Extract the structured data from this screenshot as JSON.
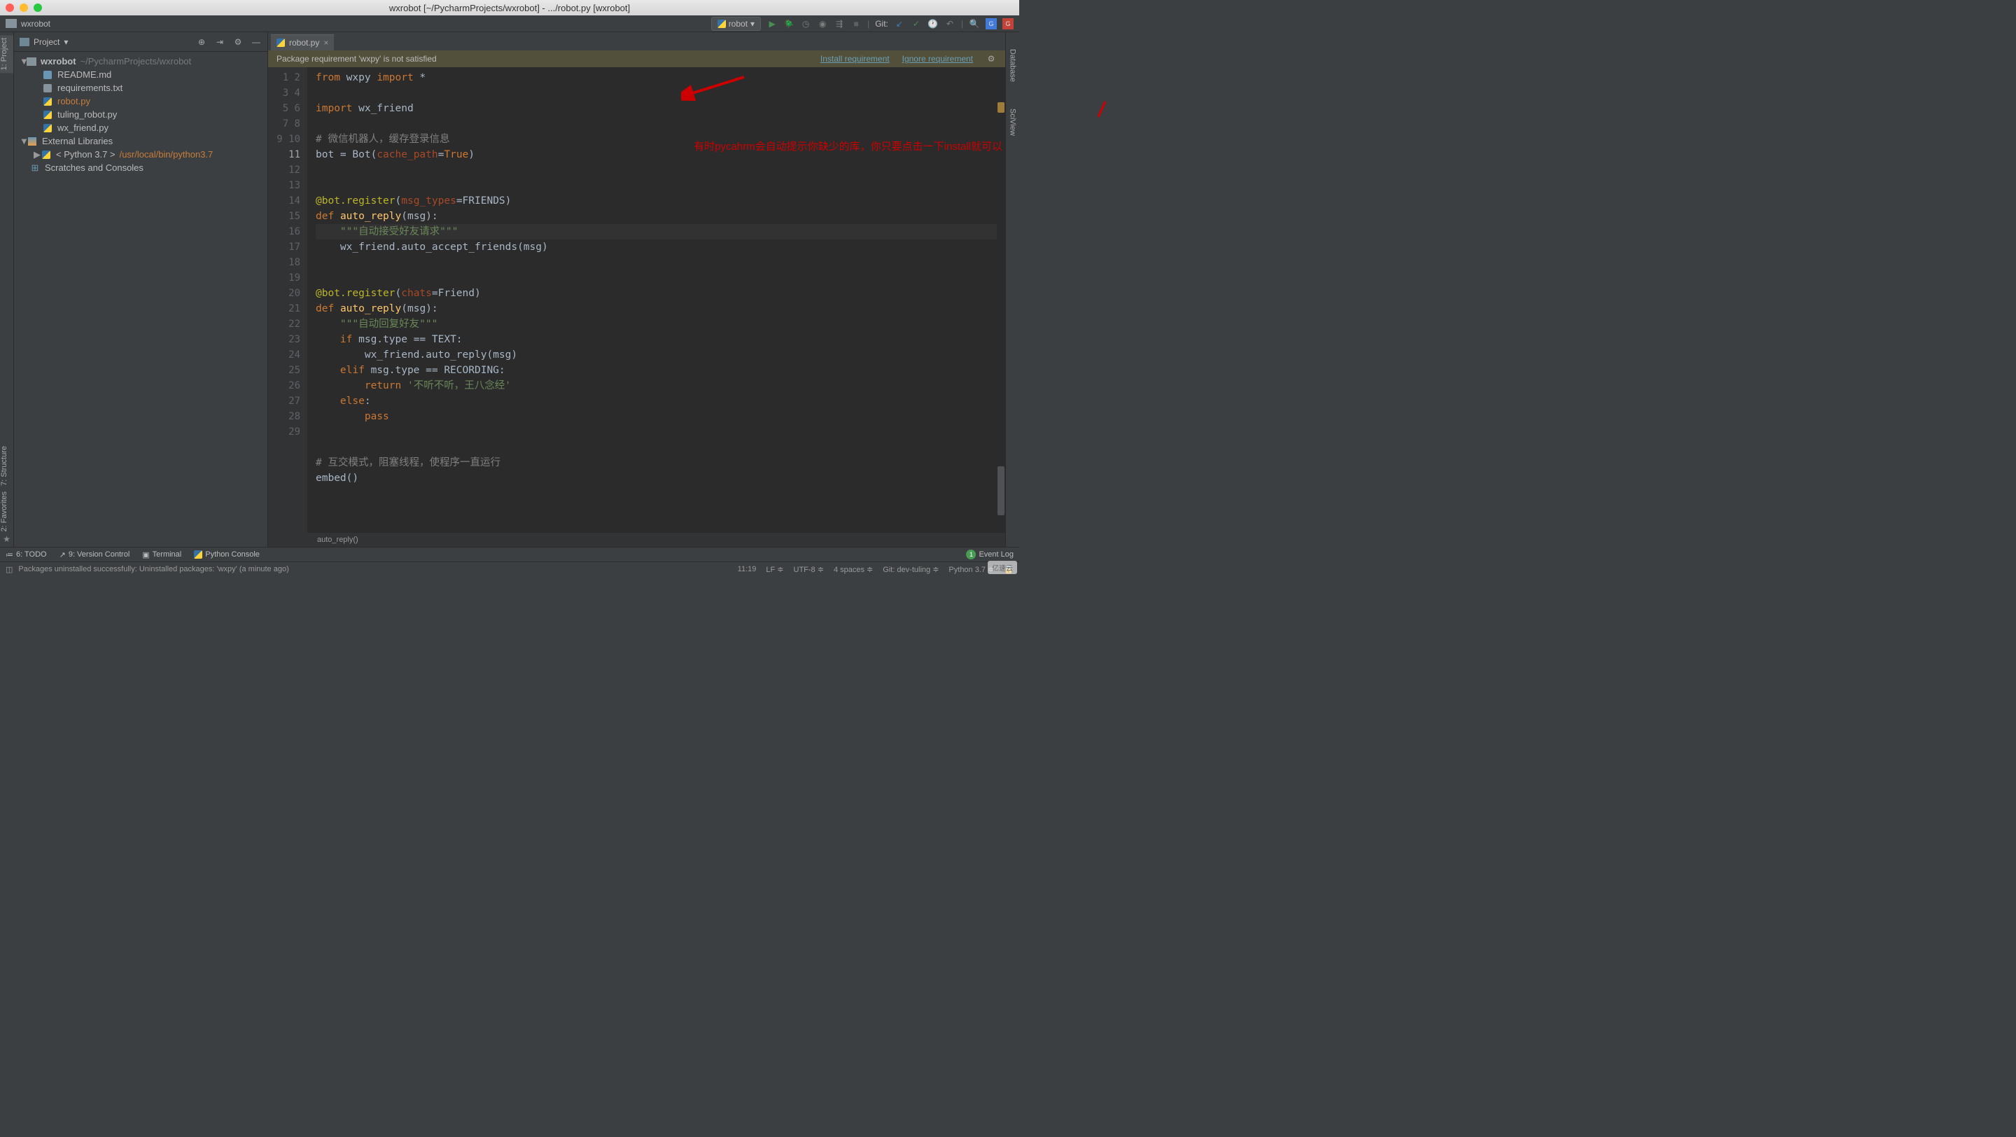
{
  "window": {
    "title": "wxrobot [~/PycharmProjects/wxrobot] - .../robot.py [wxrobot]"
  },
  "breadcrumb": {
    "project": "wxrobot"
  },
  "run_config": {
    "name": "robot"
  },
  "git_label": "Git:",
  "project_panel": {
    "title": "Project",
    "tree": {
      "root": {
        "name": "wxrobot",
        "path": "~/PycharmProjects/wxrobot"
      },
      "files": [
        {
          "name": "README.md",
          "type": "md"
        },
        {
          "name": "requirements.txt",
          "type": "txt"
        },
        {
          "name": "robot.py",
          "type": "py",
          "selected": true
        },
        {
          "name": "tuling_robot.py",
          "type": "py"
        },
        {
          "name": "wx_friend.py",
          "type": "py"
        }
      ],
      "external_libs": "External Libraries",
      "python_env": "< Python 3.7 >",
      "python_path": "/usr/local/bin/python3.7",
      "scratches": "Scratches and Consoles"
    }
  },
  "tabs": [
    {
      "name": "robot.py",
      "active": true
    }
  ],
  "notification": {
    "message": "Package requirement 'wxpy' is not satisfied",
    "install": "Install requirement",
    "ignore": "Ignore requirement"
  },
  "code": {
    "lines": [
      1,
      2,
      3,
      4,
      5,
      6,
      7,
      8,
      9,
      10,
      11,
      12,
      13,
      14,
      15,
      16,
      17,
      18,
      19,
      20,
      21,
      22,
      23,
      24,
      25,
      26,
      27,
      28,
      29
    ],
    "current_line": 11,
    "breadcrumb_fn": "auto_reply()"
  },
  "annotation": {
    "text": "有时pycahrm会自动提示你缺少的库，你只要点击一下install就可以"
  },
  "tool_windows": {
    "todo": "6: TODO",
    "vcs": "9: Version Control",
    "terminal": "Terminal",
    "console": "Python Console",
    "event_log": "Event Log"
  },
  "status": {
    "message": "Packages uninstalled successfully: Uninstalled packages: 'wxpy' (a minute ago)",
    "cursor": "11:19",
    "line_sep": "LF",
    "encoding": "UTF-8",
    "indent": "4 spaces",
    "git_branch": "Git: dev-tuling",
    "python": "Python 3.7",
    "event_count": "1"
  },
  "gutters": {
    "left_top": "1: Project",
    "left_mid1": "7: Structure",
    "left_mid2": "2: Favorites",
    "right1": "Database",
    "right2": "SciView"
  },
  "watermark": "亿速云"
}
